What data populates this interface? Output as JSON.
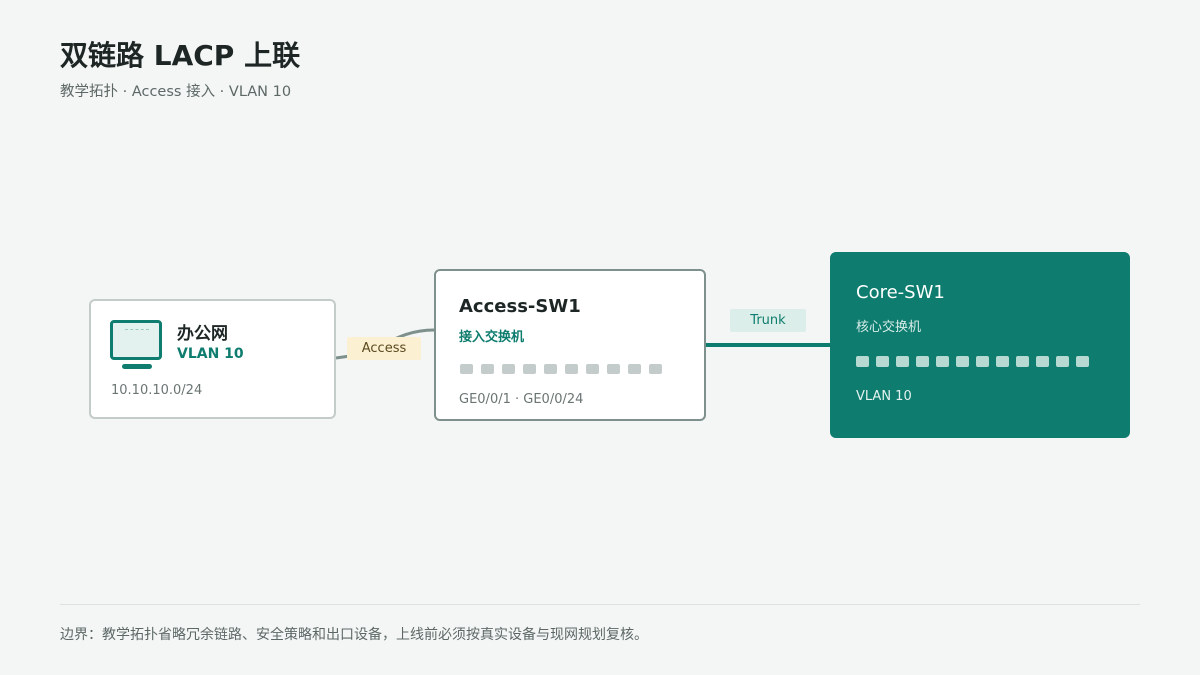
{
  "header": {
    "title": "双链路 LACP 上联",
    "subtitle": "教学拓扑 · Access 接入 · VLAN 10"
  },
  "nodes": {
    "office": {
      "name": "办公网",
      "vlan": "VLAN 10",
      "subnet": "10.10.10.0/24",
      "icon": "monitor-icon"
    },
    "access_switch": {
      "name": "Access-SW1",
      "role": "接入交换机",
      "ports_label": "GE0/0/1 · GE0/0/24",
      "port_count": 10
    },
    "core_switch": {
      "name": "Core-SW1",
      "role": "核心交换机",
      "vlan": "VLAN 10",
      "port_count": 12
    }
  },
  "links": {
    "office_to_access": {
      "label": "Access"
    },
    "access_to_core": {
      "label": "Trunk"
    }
  },
  "footer": {
    "note": "边界：教学拓扑省略冗余链路、安全策略和出口设备，上线前必须按真实设备与现网规划复核。"
  },
  "colors": {
    "accent": "#0e7c6e",
    "background": "#f4f6f5",
    "access_label_bg": "#fbf0d2",
    "trunk_label_bg": "#dceee9"
  }
}
